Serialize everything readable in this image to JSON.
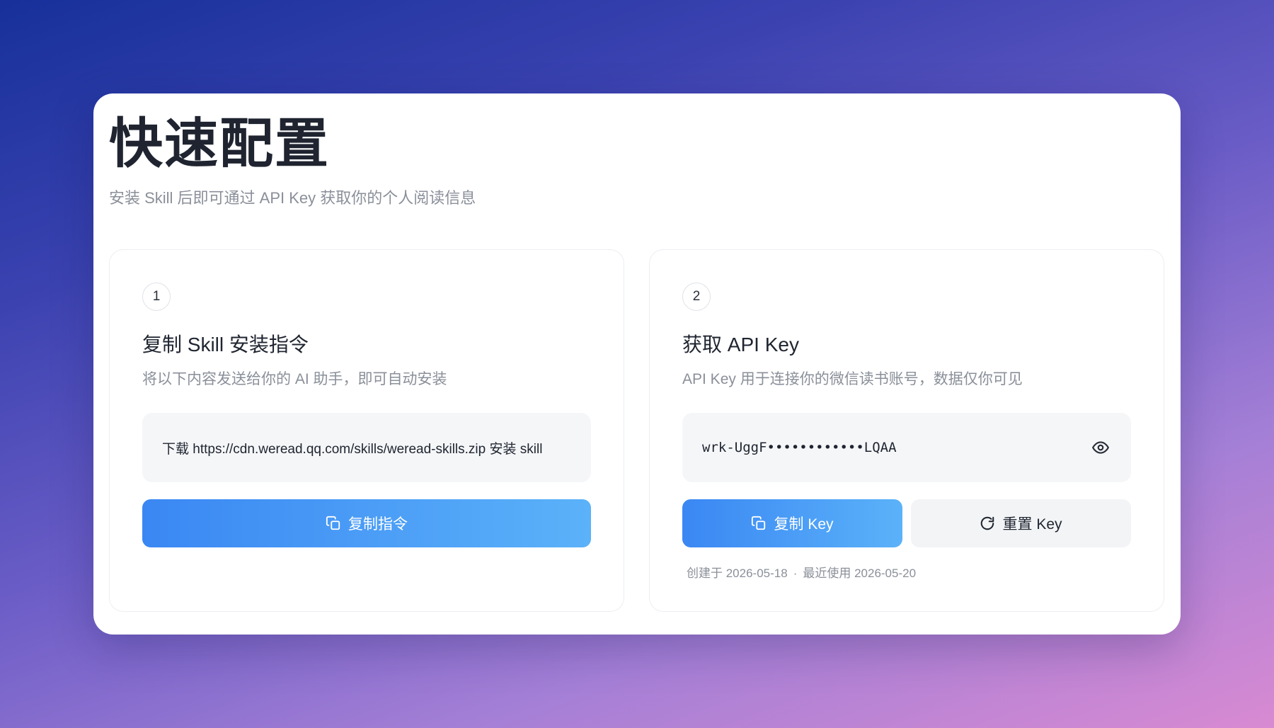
{
  "header": {
    "title": "快速配置",
    "subtitle": "安装 Skill 后即可通过 API Key 获取你的个人阅读信息"
  },
  "step1": {
    "number": "1",
    "title": "复制 Skill 安装指令",
    "description": "将以下内容发送给你的 AI 助手，即可自动安装",
    "command": "下载 https://cdn.weread.qq.com/skills/weread-skills.zip 安装 skill",
    "copy_button_label": "复制指令",
    "copy_icon": "copy-icon"
  },
  "step2": {
    "number": "2",
    "title": "获取 API Key",
    "description": "API Key 用于连接你的微信读书账号，数据仅你可见",
    "api_key_masked": "wrk-UggF••••••••••••LQAA",
    "reveal_icon": "eye-icon",
    "copy_key_label": "复制 Key",
    "reset_key_label": "重置 Key",
    "created_text": "创建于 2026-05-18",
    "separator": "·",
    "last_used_text": "最近使用 2026-05-20"
  },
  "colors": {
    "accent_start": "#3a87f3",
    "accent_end": "#5bb2f9",
    "title": "#1f2430",
    "muted": "#8a8f99"
  }
}
